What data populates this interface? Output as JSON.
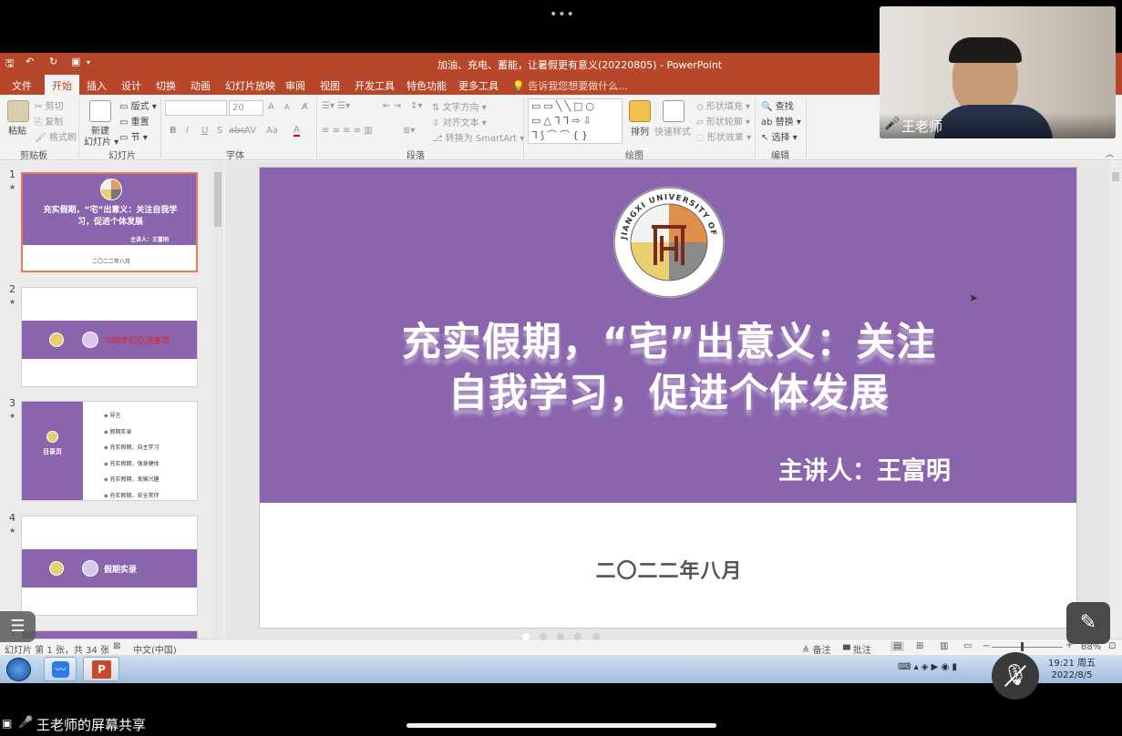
{
  "meeting": {
    "more_dots": "•••"
  },
  "window": {
    "title": "加油、充电、蓄能，让暑假更有意义(20220805) - PowerPoint"
  },
  "ribbon_tabs": [
    "文件",
    "开始",
    "插入",
    "设计",
    "切换",
    "动画",
    "幻灯片放映",
    "审阅",
    "视图",
    "开发工具",
    "特色功能",
    "更多工具"
  ],
  "tell_me": "告诉我您想要做什么...",
  "ribbon": {
    "clipboard": {
      "label": "剪贴板",
      "paste": "粘贴",
      "cut": "剪切",
      "copy": "复制",
      "format_painter": "格式刷"
    },
    "slides": {
      "label": "幻灯片",
      "new_slide": "新建",
      "new_slide_2": "幻灯片",
      "layout": "版式",
      "reset": "重置",
      "section": "节"
    },
    "font": {
      "label": "字体",
      "size": "20",
      "bold": "B",
      "italic": "I",
      "underline": "U",
      "shadow": "S",
      "strike": "abc",
      "spacing": "AV",
      "case": "Aa",
      "color": "A",
      "grow": "A",
      "shrink": "A"
    },
    "paragraph": {
      "label": "段落",
      "text_direction": "文字方向",
      "align_text": "对齐文本",
      "smartart": "转换为 SmartArt"
    },
    "drawing": {
      "label": "绘图",
      "arrange": "排列",
      "quick_styles": "快速样式",
      "shape_fill": "形状填充",
      "shape_outline": "形状轮廓",
      "shape_effects": "形状效果"
    },
    "editing": {
      "label": "编辑",
      "find": "查找",
      "replace": "替换",
      "select": "选择"
    }
  },
  "thumbnails": [
    {
      "num": "1",
      "title": "充实假期，“宅”出意义：关注自我学习，促进个体发展",
      "presenter": "主讲人：王富明",
      "date": "二〇二二年八月"
    },
    {
      "num": "2",
      "heading": "与同学们交流事项"
    },
    {
      "num": "3",
      "side": "目录页",
      "items": [
        "导言",
        "假期实录",
        "充实假期，自主学习",
        "充实假期，强身健体",
        "充实假期，发展兴趣",
        "充实假期，安全常伴"
      ]
    },
    {
      "num": "4",
      "heading": "假期实录"
    },
    {
      "num": "5"
    }
  ],
  "slide": {
    "title_line1": "充实假期，“宅”出意义：关注",
    "title_line2": "自我学习，促进个体发展",
    "presenter": "主讲人：王富明",
    "date": "二〇二二年八月",
    "logo_text": "JIANGXI UNIVERSITY OF SCIENCE AND TECHNOLOGY"
  },
  "statusbar": {
    "slide_info": "幻灯片 第 1 张，共 34 张",
    "language": "中文(中国)",
    "notes": "备注",
    "comments": "批注",
    "zoom": "88%"
  },
  "taskbar": {
    "time": "19:21 周五",
    "date": "2022/8/5"
  },
  "camera": {
    "name": "王老师"
  },
  "share_label": "王老师的屏幕共享",
  "colors": {
    "ppt_red": "#b7472a",
    "slide_purple": "#8a64ad"
  }
}
